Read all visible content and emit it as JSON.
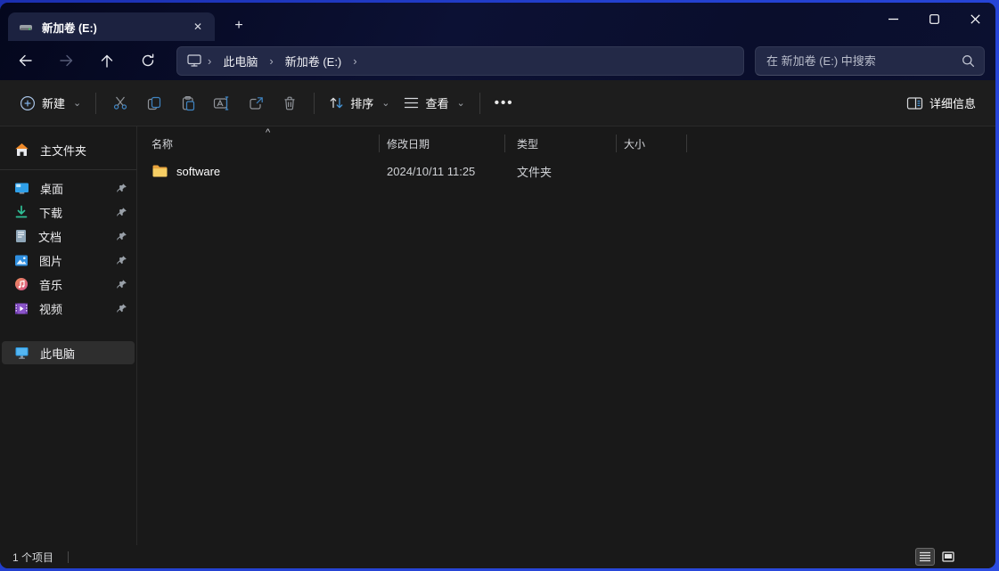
{
  "icons": {
    "close": "✕",
    "plus": "+",
    "chevron_right": "›",
    "chevron_down": "⌄",
    "sort_asc": "^",
    "more_dots": "•••",
    "drive": "hard-drive",
    "search": "magnifier",
    "back": "arrow-left",
    "forward": "arrow-right",
    "up": "arrow-up",
    "refresh": "circular-arrow",
    "pin": "pushpin",
    "folder": "yellow-folder"
  },
  "window": {
    "tab_title": "新加卷 (E:)"
  },
  "navbar": {
    "breadcrumb": [
      "此电脑",
      "新加卷 (E:)"
    ],
    "search_placeholder": "在 新加卷 (E:) 中搜索"
  },
  "toolbar": {
    "new_label": "新建",
    "sort_label": "排序",
    "view_label": "查看",
    "more_label": "•••",
    "details_label": "详细信息"
  },
  "sidebar": {
    "home": {
      "label": "主文件夹"
    },
    "pinned": [
      {
        "label": "桌面"
      },
      {
        "label": "下载"
      },
      {
        "label": "文档"
      },
      {
        "label": "图片"
      },
      {
        "label": "音乐"
      },
      {
        "label": "视频"
      }
    ],
    "this_pc": {
      "label": "此电脑"
    }
  },
  "filelist": {
    "columns": [
      "名称",
      "修改日期",
      "类型",
      "大小"
    ],
    "rows": [
      {
        "name": "software",
        "modified": "2024/10/11 11:25",
        "type": "文件夹",
        "size": ""
      }
    ]
  },
  "statusbar": {
    "items_count": "1 个项目"
  }
}
